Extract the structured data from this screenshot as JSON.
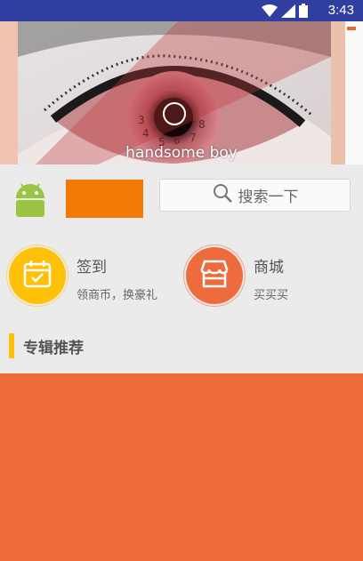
{
  "status_bar": {
    "time": "3:43",
    "icons": [
      "wifi-icon",
      "signal-icon",
      "battery-icon"
    ],
    "background": "#303f9f"
  },
  "banner": {
    "caption": "handsome boy"
  },
  "header": {
    "search_label": "搜索一下",
    "orange_block_color": "#f07a05"
  },
  "features": [
    {
      "title": "签到",
      "subtitle": "领商币，换豪礼",
      "color": "#ffc107",
      "icon": "calendar-check-icon"
    },
    {
      "title": "商城",
      "subtitle": "买买买",
      "color": "#ee6b3e",
      "icon": "store-icon"
    }
  ],
  "section": {
    "title": "专辑推荐",
    "accent": "#ffc107"
  },
  "album_block": {
    "color": "#ec6b39"
  }
}
